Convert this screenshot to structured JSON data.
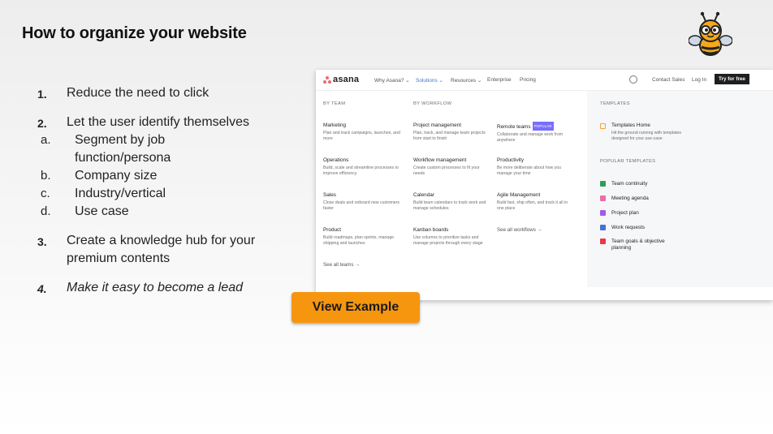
{
  "slide": {
    "title": "How to organize your website"
  },
  "list": [
    {
      "num": "1.",
      "text": "Reduce the need to click"
    },
    {
      "num": "2.",
      "text": "Let the user identify themselves",
      "subs": [
        {
          "letter": "a.",
          "text": "Segment by job function/persona"
        },
        {
          "letter": "b.",
          "text": "Company size"
        },
        {
          "letter": "c.",
          "text": "Industry/vertical"
        },
        {
          "letter": "d.",
          "text": "Use case"
        }
      ]
    },
    {
      "num": "3.",
      "text": "Create a knowledge hub for your premium contents"
    },
    {
      "num": "4.",
      "text": "Make it easy to become a lead"
    }
  ],
  "button": {
    "label": "View Example",
    "color": "#f6960f"
  },
  "site": {
    "logo": "asana",
    "nav": {
      "why": "Why Asana? ⌄",
      "solutions": "Solutions ⌄",
      "resources": "Resources ⌄",
      "enterprise": "Enterprise",
      "pricing": "Pricing",
      "contact": "Contact Sales",
      "login": "Log In",
      "try": "Try for free"
    },
    "accent": "#4573d2",
    "headers": {
      "team": "BY TEAM",
      "workflow": "BY WORKFLOW",
      "templates": "TEMPLATES",
      "popular": "POPULAR TEMPLATES"
    },
    "team": [
      {
        "title": "Marketing",
        "desc": "Plan and track campaigns, launches, and more"
      },
      {
        "title": "Operations",
        "desc": "Build, scale and streamline processes to improve efficiency"
      },
      {
        "title": "Sales",
        "desc": "Close deals and onboard new customers faster"
      },
      {
        "title": "Product",
        "desc": "Build roadmaps, plan sprints, manage shipping and launches"
      }
    ],
    "see_all_teams": "See all teams →",
    "workflow1": [
      {
        "title": "Project management",
        "desc": "Plan, track, and manage team projects from start to finish"
      },
      {
        "title": "Workflow management",
        "desc": "Create custom processes to fit your needs"
      },
      {
        "title": "Calendar",
        "desc": "Build team calendars to track work and manage schedules"
      },
      {
        "title": "Kanban boards",
        "desc": "Use columns to prioritize tasks and manage projects through every stage"
      }
    ],
    "workflow2": [
      {
        "title": "Remote teams",
        "badge": "POPULAR",
        "desc": "Collaborate and manage work from anywhere"
      },
      {
        "title": "Productivity",
        "desc": "Be more deliberate about how you manage your time"
      },
      {
        "title": "Agile Management",
        "desc": "Build fast, ship often, and track it all in one place"
      }
    ],
    "see_all_workflows": "See all workflows →",
    "templates_home": {
      "title": "Templates Home",
      "desc": "Hit the ground running with templates designed for your use-case"
    },
    "popular": [
      {
        "label": "Team continuity",
        "color": "#2e9e5b"
      },
      {
        "label": "Meeting agenda",
        "color": "#e86fa7"
      },
      {
        "label": "Project plan",
        "color": "#a35be8"
      },
      {
        "label": "Work requests",
        "color": "#4573d2"
      },
      {
        "label": "Team goals & objective planning",
        "color": "#e8384f"
      }
    ]
  }
}
